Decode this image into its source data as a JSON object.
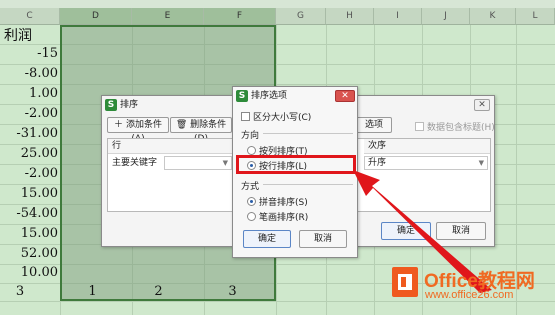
{
  "spreadsheet": {
    "columns": [
      "C",
      "D",
      "E",
      "F",
      "G",
      "H",
      "I",
      "J",
      "K",
      "L"
    ],
    "header_cell": "利润",
    "values": [
      "-15",
      "-8.00",
      "1.00",
      "-2.00",
      "-31.00",
      "25.00",
      "-2.00",
      "15.00",
      "-54.00",
      "15.00",
      "52.00",
      "10.00"
    ],
    "bottom_row": [
      "3",
      "1",
      "2",
      "3"
    ]
  },
  "sort_dialog": {
    "title": "排序",
    "add_condition": "添加条件(A)",
    "delete_condition": "删除条件(D)",
    "options_button": "选项(O)...",
    "header_checkbox": "数据包含标题(H)",
    "col_row_header": "行",
    "col_order_header": "次序",
    "primary_key_label": "主要关键字",
    "order_value": "升序",
    "ok": "确定",
    "cancel": "取消"
  },
  "options_dialog": {
    "title": "排序选项",
    "case_sensitive": "区分大小写(C)",
    "direction_label": "方向",
    "by_column": "按列排序(T)",
    "by_row": "按行排序(L)",
    "method_label": "方式",
    "pinyin": "拼音排序(S)",
    "stroke": "笔画排序(R)",
    "ok": "确定",
    "cancel": "取消"
  },
  "watermark": {
    "title": "Office教程网",
    "url": "www.office26.com"
  },
  "colors": {
    "selection_border": "#3f7a3c",
    "highlight": "#e0161b",
    "watermark": "#f06a22"
  }
}
